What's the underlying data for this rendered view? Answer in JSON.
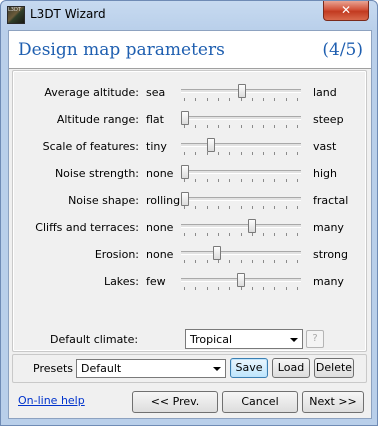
{
  "window": {
    "title": "L3DT Wizard",
    "icon_text": "L3DT",
    "close_glyph": "✕"
  },
  "header": {
    "title": "Design map parameters",
    "step": "(4/5)"
  },
  "parameters": [
    {
      "label": "Average altitude:",
      "low": "sea",
      "high": "land",
      "level": 0.5
    },
    {
      "label": "Altitude range:",
      "low": "flat",
      "high": "steep",
      "level": 0.0
    },
    {
      "label": "Scale of features:",
      "low": "tiny",
      "high": "vast",
      "level": 0.23
    },
    {
      "label": "Noise strength:",
      "low": "none",
      "high": "high",
      "level": 0.0
    },
    {
      "label": "Noise shape:",
      "low": "rolling",
      "high": "fractal",
      "level": 0.0
    },
    {
      "label": "Cliffs and terraces:",
      "low": "none",
      "high": "many",
      "level": 0.59
    },
    {
      "label": "Erosion:",
      "low": "none",
      "high": "strong",
      "level": 0.28
    },
    {
      "label": "Lakes:",
      "low": "few",
      "high": "many",
      "level": 0.49
    }
  ],
  "climate": {
    "label": "Default climate:",
    "value": "Tropical",
    "help": "?"
  },
  "presets": {
    "label": "Presets",
    "value": "Default",
    "save": "Save",
    "load": "Load",
    "delete": "Delete"
  },
  "footer": {
    "help_link": "On-line help",
    "prev": "<< Prev.",
    "cancel": "Cancel",
    "next": "Next >>"
  },
  "colors": {
    "accent": "#1f5fb0",
    "link": "#0033cc",
    "close": "#c23a20"
  }
}
